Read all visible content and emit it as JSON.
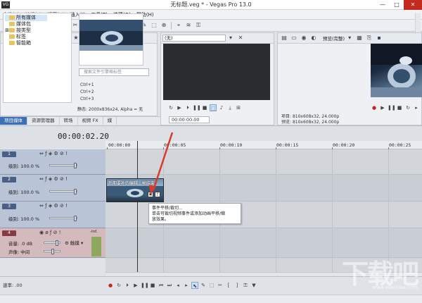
{
  "window": {
    "title": "无标题.veg * - Vegas Pro 13.0",
    "app_icon": "VG",
    "minimize": "—",
    "maximize": "□",
    "close": "✕"
  },
  "menu": [
    "文件(F)",
    "编辑(E)",
    "视图(V)",
    "插入(I)",
    "工具(T)",
    "选项(O)",
    "帮助(H)"
  ],
  "explorer": {
    "tree": [
      {
        "label": "所有媒体",
        "selected": true,
        "expander": ""
      },
      {
        "label": "媒体包",
        "expander": ""
      },
      {
        "label": "按类型",
        "expander": "⊞"
      },
      {
        "label": "标签",
        "expander": ""
      },
      {
        "label": "智能箱",
        "expander": ""
      }
    ],
    "search_placeholder": "搜索文件引擎格标签",
    "shortcuts": [
      "Ctrl+1",
      "Ctrl+2",
      "Ctrl+3"
    ],
    "media_info": "静态: 2000x836x24, Alpha = 无"
  },
  "tabs": [
    "项目媒体",
    "资源管理器",
    "转场",
    "视频 FX",
    "媒"
  ],
  "trimmer": {
    "dropdown": "(无)",
    "timecode": "00:00:00.00"
  },
  "preview": {
    "mode_label": "预览(完整)",
    "project_label": "项目:",
    "project_value": "810x608x32, 24.000p",
    "preview_label": "预览:",
    "preview_value": "810x608x32, 24.000p"
  },
  "timeline": {
    "timecode": "00:00:02.20",
    "ruler": [
      "00:00:00",
      "00:00:05",
      "00:00:10",
      "00:00:15",
      "00:00:20",
      "00:00:25"
    ],
    "video_tracks": [
      {
        "number": "1",
        "level_label": "级别:",
        "level_value": "100.0 %"
      },
      {
        "number": "2",
        "level_label": "级别:",
        "level_value": "100.0 %"
      },
      {
        "number": "3",
        "level_label": "级别:",
        "level_value": "100.0 %"
      }
    ],
    "audio_track": {
      "number": "4",
      "volume_label": "音量:",
      "volume_value": ".0 dB",
      "pan_label": "声像:",
      "pan_value": "中间",
      "mode": "触摸",
      "meter_label": "-Inf."
    },
    "clip_title": "后期要补的编辑...帧结束",
    "tooltip_line1": "事件平移/裁切...",
    "tooltip_line2": "单击可裁切视频事件或添加动画平移/缩",
    "tooltip_line3": "放效果。"
  },
  "rate_label": "速率: .00",
  "watermark": {
    "text": "下载吧",
    "sub": "www.xiazaiba.com"
  },
  "colors": {
    "accent": "#3d6fb6",
    "video_header": "#b9c4d6",
    "audio_header": "#d4b9bd",
    "arrow": "#d93a2b"
  }
}
